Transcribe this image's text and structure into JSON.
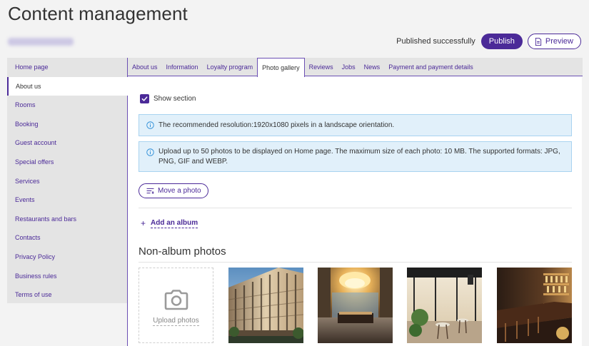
{
  "header": {
    "title": "Content management",
    "status": "Published successfully",
    "publish_label": "Publish",
    "preview_label": "Preview"
  },
  "sidebar": {
    "items": [
      {
        "label": "Home page"
      },
      {
        "label": "About us"
      },
      {
        "label": "Rooms"
      },
      {
        "label": "Booking"
      },
      {
        "label": "Guest account"
      },
      {
        "label": "Special offers"
      },
      {
        "label": "Services"
      },
      {
        "label": "Events"
      },
      {
        "label": "Restaurants and bars"
      },
      {
        "label": "Contacts"
      },
      {
        "label": "Privacy Policy"
      },
      {
        "label": "Business rules"
      },
      {
        "label": "Terms of use"
      }
    ],
    "active": "About us"
  },
  "tabs": {
    "items": [
      {
        "label": "About us"
      },
      {
        "label": "Information"
      },
      {
        "label": "Loyalty program"
      },
      {
        "label": "Photo gallery"
      },
      {
        "label": "Reviews"
      },
      {
        "label": "Jobs"
      },
      {
        "label": "News"
      },
      {
        "label": "Payment and payment details"
      }
    ],
    "active": "Photo gallery"
  },
  "gallery": {
    "show_section_label": "Show section",
    "show_section_checked": true,
    "info_resolution": "The recommended resolution:1920x1080 pixels in a landscape orientation.",
    "info_upload": "Upload up to 50 photos to be displayed on Home page. The maximum size of each photo: 10 MB. The supported formats: JPG, PNG, GIF and WEBP.",
    "move_photo_label": "Move a photo",
    "add_album_label": "Add an album",
    "non_album_title": "Non-album photos",
    "upload_label": "Upload photos"
  },
  "icons": {
    "info": "info-icon",
    "check": "checkmark-icon",
    "move": "move-list-icon",
    "preview": "document-icon",
    "plus": "plus-icon",
    "camera": "camera-icon"
  },
  "colors": {
    "accent": "#4b2a98",
    "info_bg": "#e1f0fa",
    "info_border": "#a9d3f0",
    "info_icon": "#2f8fd8"
  }
}
